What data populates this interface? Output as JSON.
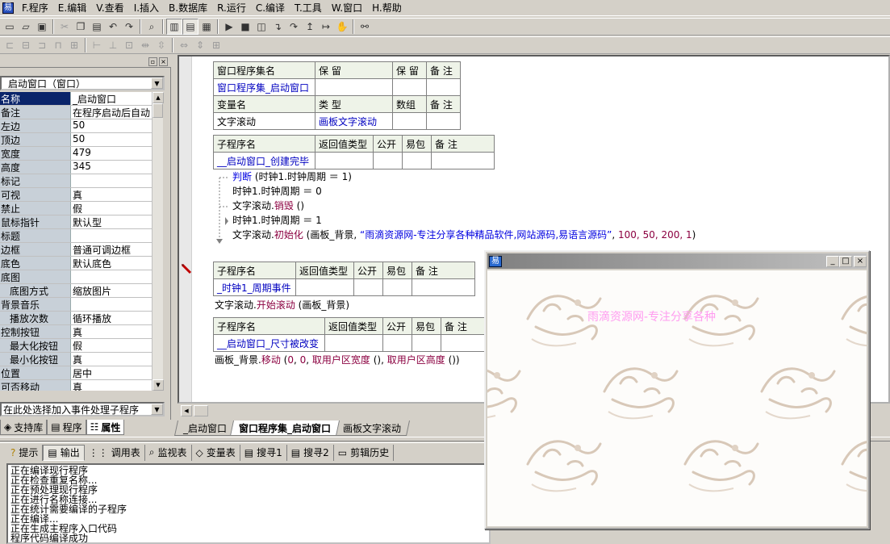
{
  "menu": {
    "items": [
      "F.程序",
      "E.编辑",
      "V.查看",
      "I.插入",
      "B.数据库",
      "R.运行",
      "C.编译",
      "T.工具",
      "W.窗口",
      "H.帮助"
    ]
  },
  "left_panel": {
    "selector_value": "_启动窗口（窗口）",
    "properties": [
      {
        "name": "名称",
        "value": "_启动窗口",
        "indent": false,
        "selected": true
      },
      {
        "name": "备注",
        "value": "在程序启动后自动",
        "indent": false
      },
      {
        "name": "左边",
        "value": "50",
        "indent": false
      },
      {
        "name": "顶边",
        "value": "50",
        "indent": false
      },
      {
        "name": "宽度",
        "value": "479",
        "indent": false
      },
      {
        "name": "高度",
        "value": "345",
        "indent": false
      },
      {
        "name": "标记",
        "value": "",
        "indent": false
      },
      {
        "name": "可视",
        "value": "真",
        "indent": false
      },
      {
        "name": "禁止",
        "value": "假",
        "indent": false
      },
      {
        "name": "鼠标指针",
        "value": "默认型",
        "indent": false
      },
      {
        "name": "标题",
        "value": "",
        "indent": false
      },
      {
        "name": "边框",
        "value": "普通可调边框",
        "indent": false
      },
      {
        "name": "底色",
        "value": "默认底色",
        "indent": false
      },
      {
        "name": "底图",
        "value": "",
        "indent": false
      },
      {
        "name": "底图方式",
        "value": "缩放图片",
        "indent": true
      },
      {
        "name": "背景音乐",
        "value": "",
        "indent": false
      },
      {
        "name": "播放次数",
        "value": "循环播放",
        "indent": true
      },
      {
        "name": "控制按钮",
        "value": "真",
        "indent": false
      },
      {
        "name": "最大化按钮",
        "value": "假",
        "indent": true
      },
      {
        "name": "最小化按钮",
        "value": "真",
        "indent": true
      },
      {
        "name": "位置",
        "value": "居中",
        "indent": false
      },
      {
        "name": "可否移动",
        "value": "真",
        "indent": false
      }
    ],
    "event_combo": "在此处选择加入事件处理子程序",
    "tabs": [
      "支持库",
      "程序",
      "属性"
    ]
  },
  "editor": {
    "assembly_table": {
      "header": [
        "窗口程序集名",
        "保 留",
        "保 留",
        "备 注"
      ],
      "row": [
        "窗口程序集_启动窗口",
        "",
        "",
        ""
      ],
      "var_header": [
        "变量名",
        "类 型",
        "数组",
        "备 注"
      ],
      "var_row": [
        "文字滚动",
        "画板文字滚动",
        "",
        ""
      ]
    },
    "sub1": {
      "header": [
        "子程序名",
        "返回值类型",
        "公开",
        "易包",
        "备 注"
      ],
      "name": "__启动窗口_创建完毕"
    },
    "code1": {
      "l1_kw": "判断",
      "l1_rest": " (时钟1.时钟周期 ＝ 1)",
      "l2": "时钟1.时钟周期 ＝ 0",
      "l3_obj": "文字滚动.",
      "l3_fn": "销毁",
      "l3_rest": " ()",
      "l4": "时钟1.时钟周期 ＝ 1",
      "l5_obj": "文字滚动.",
      "l5_fn": "初始化",
      "l5_a": " (画板_背景, ",
      "l5_str": "“雨滴资源网-专注分享各种精品软件,网站源码,易语言源码”",
      "l5_b": ", ",
      "l5_nums": "100, 50, 200, 1",
      "l5_c": ")"
    },
    "sub2": {
      "header": [
        "子程序名",
        "返回值类型",
        "公开",
        "易包",
        "备 注"
      ],
      "name": "_时钟1_周期事件"
    },
    "code2": {
      "obj": "文字滚动.",
      "fn": "开始滚动",
      "rest": " (画板_背景)"
    },
    "sub3": {
      "header": [
        "子程序名",
        "返回值类型",
        "公开",
        "易包",
        "备 注"
      ],
      "name": "__启动窗口_尺寸被改变"
    },
    "code3": {
      "obj": "画板_背景.",
      "fn": "移动",
      "a": " (",
      "n1": "0",
      "sep": ", ",
      "n2": "0",
      "b": ", ",
      "f1": "取用户区宽度",
      "c": " (), ",
      "f2": "取用户区高度",
      "d": " ())"
    },
    "tabs": [
      "_启动窗口",
      "窗口程序集_启动窗口",
      "画板文字滚动"
    ]
  },
  "bottom": {
    "tabs": [
      "提示",
      "输出",
      "调用表",
      "监视表",
      "变量表",
      "搜寻1",
      "搜寻2",
      "剪辑历史"
    ],
    "output": [
      "正在编译现行程序",
      "正在检查重复名称...",
      "正在预处理现行程序",
      "正在进行名称连接...",
      "正在统计需要编译的子程序",
      "正在编译...",
      "正在生成主程序入口代码",
      "程序代码编译成功"
    ]
  },
  "popup": {
    "scroll_text": "雨滴资源网-专注分享各种"
  },
  "colors": {
    "accent": "#0a246a",
    "keyword": "#0000e0",
    "function": "#8b0040",
    "scroll_text": "#ff9cf0"
  }
}
